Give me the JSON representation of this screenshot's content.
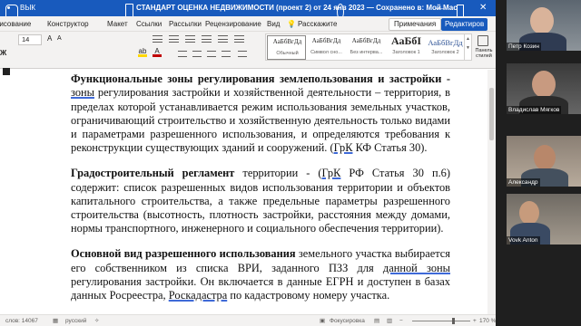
{
  "window": {
    "title": "СТАНДАРТ ОЦЕНКА НЕДВИЖИМОСТИ (проект 2) от 24 янв 2023 — Сохранено в: Мой Мас",
    "autosave_label": "ВЫК",
    "minimize": "—",
    "close": "✕"
  },
  "ribbon": {
    "tabs": [
      "Рисование",
      "Конструктор",
      "Макет",
      "Ссылки",
      "Рассылки",
      "Рецензирование",
      "Вид",
      "Расскажите"
    ],
    "active_tab": "",
    "notes_button": "Примечания",
    "editing_button": "Редактиров",
    "font_size": "14",
    "font_grow": "A",
    "font_shrink": "A",
    "bold": "Ж",
    "highlight": "ab",
    "font_color": "A",
    "styles": [
      {
        "preview": "АаБбВгДд",
        "name": "Обычный"
      },
      {
        "preview": "АаБбВгДд",
        "name": "Символ сно..."
      },
      {
        "preview": "АаБбВгДд",
        "name": "Без интерва..."
      },
      {
        "preview": "АаБбI",
        "name": "Заголовок 1"
      },
      {
        "preview": "АаБбВгДд",
        "name": "Заголовок 2"
      }
    ],
    "styles_pane_label": "Панель стилей"
  },
  "document": {
    "p1": {
      "bold": "Функциональные зоны регулирования землепользования и застройки",
      "dash": " - ",
      "underlined": "зоны",
      "rest": " регулирования застройки и хозяйственной деятельности – территория, в пределах которой устанавливается режим использования земельных участков, ограничивающий строительство и хозяйственную деятельность только видами и параметрами разрешенного использования, и определяются требования к реконструкции существующих зданий и сооружений. (",
      "ref": "ГрК",
      "end": " КФ Статья 30)."
    },
    "p2": {
      "bold": "Градостроительный регламент",
      "mid": " территории - (",
      "ref": "ГрК",
      "rest": " РФ Статья 30 п.6) содержит: список разрешенных видов использования территории и объектов капитального строительства, а также предельные параметры разрешенного строительства (высотность, плотность застройки, расстояния между домами, нормы транспортного, инженерного и социального обеспечения территории)."
    },
    "p3": {
      "bold": "Основной вид разрешенного использования",
      "rest1": " земельного участка выбирается его собственником из списка ВРИ, заданного ПЗЗ для ",
      "underlined": "данной  зоны",
      "rest2": " регулирования застройки. Он включается в данные ЕГРН и доступен в базах данных Росреестра, ",
      "underlined2": "Роскадастра",
      "rest3": " по кадастровому номеру участка."
    }
  },
  "statusbar": {
    "words": "слов: 14067",
    "language": "русский",
    "focus": "Фокусировка",
    "zoom": "170 %",
    "zoom_minus": "−",
    "zoom_plus": "+"
  },
  "participants": [
    {
      "name": "Петр Козин"
    },
    {
      "name": "Владислав Мягков"
    },
    {
      "name": "Александр"
    },
    {
      "name": "Vovk Anton"
    }
  ],
  "colors": {
    "titlebar": "#185abd",
    "accent": "#185abd",
    "link_underline": "#3f6ad8"
  },
  "zoom_percent": 170
}
